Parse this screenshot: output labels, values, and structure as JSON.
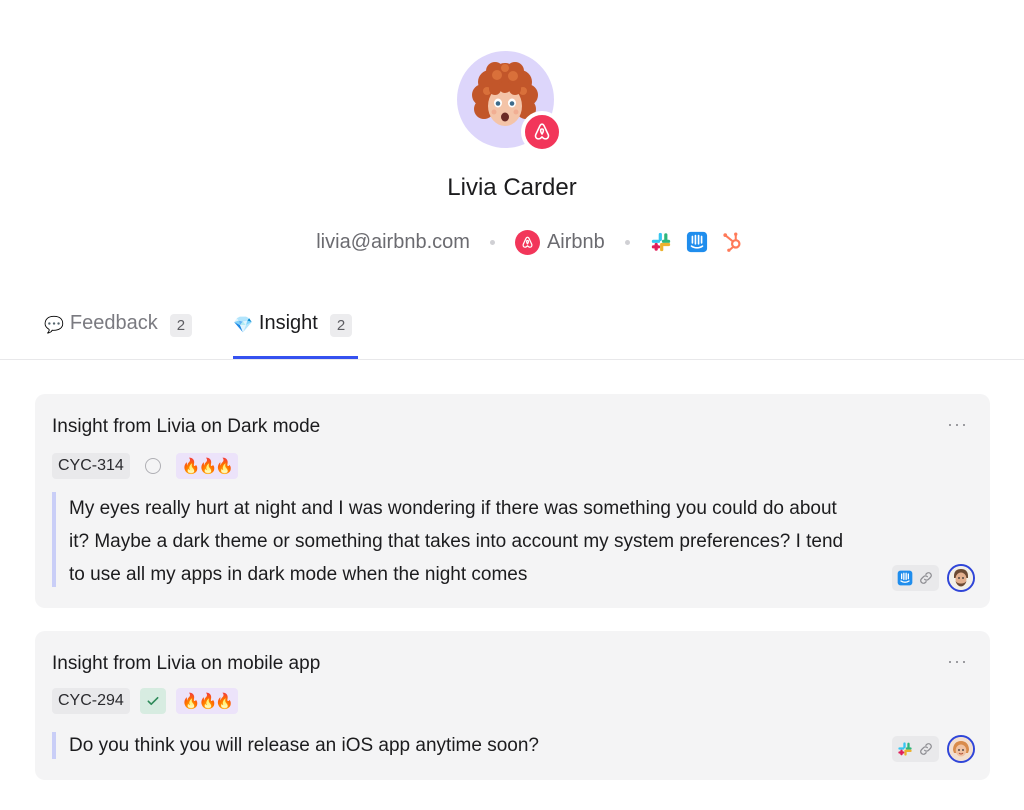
{
  "profile": {
    "name": "Livia Carder",
    "email": "livia@airbnb.com",
    "company": "Airbnb",
    "integrations": [
      "slack-icon",
      "intercom-icon",
      "hubspot-icon"
    ]
  },
  "tabs": [
    {
      "emoji": "💬",
      "label": "Feedback",
      "count": "2",
      "active": false
    },
    {
      "emoji": "💎",
      "label": "Insight",
      "count": "2",
      "active": true
    }
  ],
  "insights": [
    {
      "title": "Insight from Livia on Dark mode",
      "id": "CYC-314",
      "status": "open",
      "priority": "🔥🔥🔥",
      "quote": "My eyes really hurt at night and I was wondering if there was something you could do about it? Maybe a dark theme or something that takes into account my system preferences? I tend to use all my apps in dark mode when the night comes",
      "source": "intercom-icon"
    },
    {
      "title": "Insight from Livia on mobile app",
      "id": "CYC-294",
      "status": "done",
      "priority": "🔥🔥🔥",
      "quote": "Do you think you will release an iOS app anytime soon?",
      "source": "slack-icon"
    }
  ],
  "more_label": "···",
  "colors": {
    "accent": "#3551f0",
    "airbnb": "#f2365a",
    "avatar_bg": "#ddd6fb",
    "quote_bar": "#c9cef7",
    "done_bg": "#d7ece1",
    "priority_bg": "#ece3fa"
  }
}
